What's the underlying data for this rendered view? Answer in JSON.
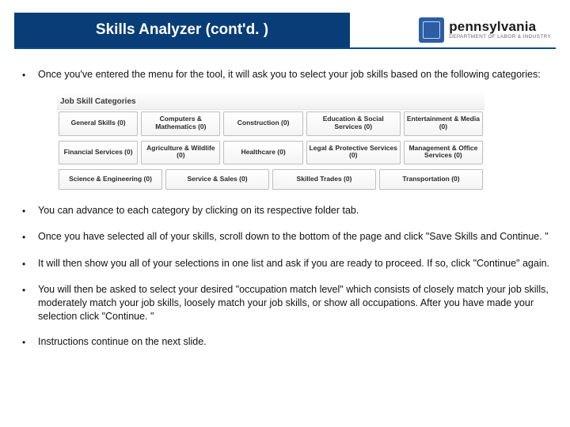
{
  "header": {
    "title": "Skills Analyzer (cont'd. )",
    "logo_state": "pennsylvania",
    "logo_dept": "DEPARTMENT OF LABOR & INDUSTRY"
  },
  "bullets": [
    "Once you've entered the menu for the tool, it will ask you to select your job skills based on the following categories:",
    "You can advance to each category by clicking on its respective folder tab.",
    "Once you have selected all of your skills, scroll down to the bottom of the page and click \"Save Skills and Continue. \"",
    "It will then show you all of your selections in one list and ask if you are ready to proceed. If so, click \"Continue\" again.",
    "You will then be asked to select your desired \"occupation match level\" which consists of closely match your job skills, moderately match your job skills, loosely match your job skills, or show all occupations. After you have made your selection click \"Continue. \"",
    "Instructions continue on the next slide."
  ],
  "categories": {
    "heading": "Job Skill Categories",
    "rows": [
      [
        "General Skills (0)",
        "Computers & Mathematics (0)",
        "Construction (0)",
        "Education & Social Services (0)",
        "Entertainment & Media (0)"
      ],
      [
        "Financial Services (0)",
        "Agriculture & Wildlife (0)",
        "Healthcare (0)",
        "Legal & Protective Services (0)",
        "Management & Office Services (0)"
      ],
      [
        "Science & Engineering (0)",
        "Service & Sales (0)",
        "Skilled Trades (0)",
        "Transportation (0)"
      ]
    ]
  }
}
